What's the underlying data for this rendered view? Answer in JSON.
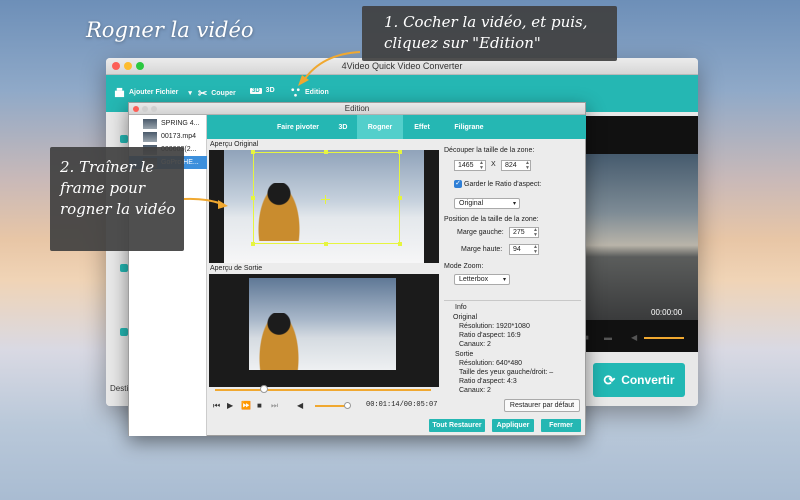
{
  "headline": "Rogner la vidéo",
  "callouts": {
    "step1": "1. Cocher la vidéo, et puis, cliquez sur \"Edition\"",
    "step2": "2. Traîner le frame pour rogner la vidéo"
  },
  "main_window": {
    "title": "4Video Quick Video Converter",
    "toolbar": {
      "add_file": "Ajouter Fichier",
      "cut": "Couper",
      "three_d": "3D",
      "edit": "Edition"
    },
    "preview_time": "00:00:00",
    "convert_label": "Convertir",
    "destination_label": "Desti"
  },
  "dialog": {
    "title": "Edition",
    "files": [
      {
        "name": "SPRING 4..."
      },
      {
        "name": "00173.mp4"
      },
      {
        "name": "000603(2..."
      },
      {
        "name": "GoPro HE..."
      }
    ],
    "tabs": [
      "Faire pivoter",
      "3D",
      "Rogner",
      "Effet",
      "Filigrane"
    ],
    "active_tab": "Rogner",
    "original_preview_label": "Aperçu Original",
    "output_preview_label": "Aperçu de Sortie",
    "time_display": "00:01:14/00:05:07",
    "crop": {
      "size_label": "Découper la taille de la zone:",
      "width": "1465",
      "x_sep": "X",
      "height": "824",
      "keep_ratio_label": "Garder le Ratio d'aspect:",
      "keep_ratio_checked": true,
      "ratio_value": "Original",
      "position_label": "Position de la taille de la zone:",
      "left_margin_label": "Marge gauche:",
      "left_margin": "275",
      "top_margin_label": "Marge haute:",
      "top_margin": "94",
      "zoom_label": "Mode Zoom:",
      "zoom_value": "Letterbox"
    },
    "info": {
      "title": "Info",
      "original_title": "Original",
      "original_lines": [
        "Résolution: 1920*1080",
        "Ratio d'aspect: 16:9",
        "Canaux: 2"
      ],
      "output_title": "Sortie",
      "output_lines": [
        "Résolution: 640*480",
        "Taille des yeux gauche/droit: –",
        "Ratio d'aspect: 4:3",
        "Canaux: 2"
      ]
    },
    "restore_default": "Restaurer par défaut",
    "buttons": {
      "restore_all": "Tout Restaurer",
      "apply": "Appliquer",
      "close": "Fermer"
    }
  },
  "colors": {
    "accent": "#25b7b3",
    "crop_frame": "#e6f53f",
    "seek": "#f0a830"
  }
}
